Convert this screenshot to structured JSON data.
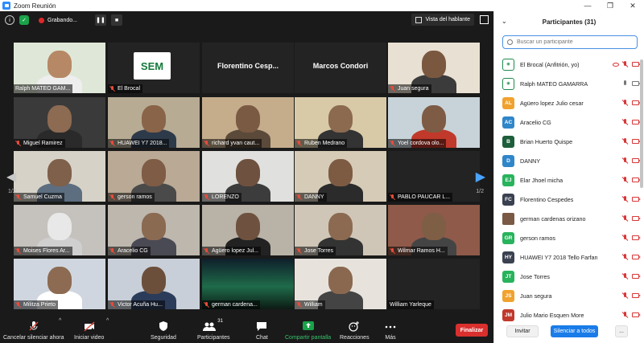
{
  "window": {
    "title": "Zoom Reunión",
    "controls": [
      "—",
      "❐",
      "✕"
    ]
  },
  "topbar": {
    "recording_label": "Grabando...",
    "view_button": "Vista del hablante"
  },
  "gallery": {
    "page_left": "1/2",
    "page_right": "1/2",
    "tiles": [
      {
        "name": "Ralph MATEO GAM...",
        "active": true,
        "muted": false,
        "video": true,
        "scene": "#dfe8d8",
        "skin": "#b78866",
        "shirt": "#eeeeee"
      },
      {
        "name": "El Brocal",
        "muted": true,
        "video": false,
        "logo": "SEM"
      },
      {
        "name": "Florentino Cesp...",
        "muted": false,
        "video": false,
        "bigname": "Florentino  Cesp..."
      },
      {
        "name": "Marcos Condori",
        "muted": false,
        "video": false,
        "bigname": "Marcos Condori"
      },
      {
        "name": "Juan segura",
        "muted": true,
        "video": true,
        "scene": "#e8e0d2",
        "skin": "#7a5840",
        "shirt": "#3b3b3b"
      },
      {
        "name": "Miguel Ramirez",
        "muted": true,
        "video": true,
        "scene": "#3a3a3a",
        "skin": "#8d6a52",
        "shirt": "#2a2a2a"
      },
      {
        "name": "HUAWEI Y7 2018...",
        "muted": true,
        "video": true,
        "scene": "#b7ab94",
        "skin": "#8a6448",
        "shirt": "#2d3a4a"
      },
      {
        "name": "richard yvan caut...",
        "muted": true,
        "video": true,
        "scene": "#c5ad8c",
        "skin": "#7b5a43",
        "shirt": "#5b4a3a"
      },
      {
        "name": "Ruben Medrano",
        "muted": true,
        "video": true,
        "scene": "#d8c9a7",
        "skin": "#8b6a50",
        "shirt": "#333333"
      },
      {
        "name": "Yoel cordova olo...",
        "muted": true,
        "video": true,
        "scene": "#c7d3d9",
        "skin": "#7e5b44",
        "shirt": "#c0392b"
      },
      {
        "name": "Samuel Cuzma",
        "muted": true,
        "video": true,
        "scene": "#d7d2c7",
        "skin": "#7f604a",
        "shirt": "#5c6e80"
      },
      {
        "name": "gerson ramos",
        "muted": true,
        "video": true,
        "scene": "#b9a995",
        "skin": "#7e5c45",
        "shirt": "#4a4a4a"
      },
      {
        "name": "LORENZO",
        "muted": true,
        "video": true,
        "scene": "#e0e0de",
        "skin": "#6e513e",
        "shirt": "#3c3c3c"
      },
      {
        "name": "DANNY",
        "muted": true,
        "video": true,
        "scene": "#d6cbb6",
        "skin": "#7d5b43",
        "shirt": "#2b2b2b"
      },
      {
        "name": "PABLO PAUCAR L...",
        "muted": true,
        "video": false
      },
      {
        "name": "Moises Flores Ar...",
        "muted": true,
        "video": true,
        "scene": "#c5c2bd",
        "skin": "#e8e8e8",
        "shirt": "#cfcfcf"
      },
      {
        "name": "Aracelio CG",
        "muted": true,
        "video": true,
        "scene": "#bdb7ae",
        "skin": "#8b6a52",
        "shirt": "#4a4a55"
      },
      {
        "name": "Agüero lopez Jul...",
        "muted": true,
        "video": true,
        "scene": "#b9b2a6",
        "skin": "#6e523f",
        "shirt": "#222222"
      },
      {
        "name": "Jose Torres",
        "muted": true,
        "video": true,
        "scene": "#cfc6b7",
        "skin": "#8c6a51",
        "shirt": "#333333"
      },
      {
        "name": "Wilmar Ramos H...",
        "muted": true,
        "video": true,
        "scene": "#8f5a4a",
        "skin": "#7f5e46",
        "shirt": "#444444"
      },
      {
        "name": "Militza Prieto",
        "muted": true,
        "video": true,
        "scene": "#cfd6df",
        "skin": "#8c6b52",
        "shirt": "#ffffff"
      },
      {
        "name": "Victor Acuña Hu...",
        "muted": true,
        "video": true,
        "scene": "#c8cfd8",
        "skin": "#6c4f3b",
        "shirt": "#2b3b5a"
      },
      {
        "name": "german cardena...",
        "muted": true,
        "video": true,
        "scene": "#1c3b2f",
        "aurora": true
      },
      {
        "name": "William",
        "muted": true,
        "video": true,
        "scene": "#e7e3dc",
        "skin": "#8a684f",
        "shirt": "#444444"
      },
      {
        "name": "William Yarleque",
        "muted": false,
        "video": false
      }
    ]
  },
  "toolbar": {
    "mute": "Cancelar silenciar ahora",
    "video": "Iniciar video",
    "security": "Seguridad",
    "participants": "Participantes",
    "participants_count": "31",
    "chat": "Chat",
    "share": "Compartir pantalla",
    "reactions": "Reacciones",
    "more": "Más",
    "finish": "Finalizar"
  },
  "panel": {
    "title": "Participantes (31)",
    "search_placeholder": "Buscar un participante",
    "invite": "Invitar",
    "mute_all": "Silenciar a todos",
    "more": "...",
    "participants": [
      {
        "name": "El Brocal (Anfitrión, yo)",
        "avatar": "logo",
        "color": "#1f8a4c",
        "eye": true,
        "mic": "off",
        "cam": "off"
      },
      {
        "name": "Ralph MATEO GAMARRA",
        "avatar": "logo",
        "color": "#1f8a4c",
        "mic": "on",
        "cam": "on"
      },
      {
        "name": "Agüero lopez Julio cesar",
        "initials": "AL",
        "color": "#f0a22e",
        "mic": "off",
        "cam": "on"
      },
      {
        "name": "Aracelio CG",
        "initials": "AC",
        "color": "#2f86c9",
        "mic": "off",
        "cam": "on"
      },
      {
        "name": "Brian Huerto Quispe",
        "initials": "B",
        "color": "#1e5e3a",
        "mic": "off",
        "cam": "on"
      },
      {
        "name": "DANNY",
        "initials": "D",
        "color": "#2f86c9",
        "mic": "off",
        "cam": "on"
      },
      {
        "name": "Elar Jhoel micha",
        "initials": "EJ",
        "color": "#28b35c",
        "mic": "off",
        "cam": "on"
      },
      {
        "name": "Florentino Cespedes",
        "initials": "FC",
        "color": "#3a4150",
        "mic": "off",
        "cam": "on"
      },
      {
        "name": "german cardenas orizano",
        "avatar": "photo",
        "color": "#7a5a44",
        "mic": "off",
        "cam": "on"
      },
      {
        "name": "gerson ramos",
        "initials": "GR",
        "color": "#28b35c",
        "mic": "off",
        "cam": "on"
      },
      {
        "name": "HUAWEI Y7 2018 Tello Farfan",
        "initials": "HY",
        "color": "#3a4150",
        "mic": "off",
        "cam": "on"
      },
      {
        "name": "Jose Torres",
        "initials": "JT",
        "color": "#28b35c",
        "mic": "off",
        "cam": "on"
      },
      {
        "name": "Juan segura",
        "initials": "JS",
        "color": "#f0a22e",
        "mic": "off",
        "cam": "on"
      },
      {
        "name": "Julio Mario Esquen More",
        "initials": "JM",
        "color": "#c0392b",
        "mic": "off",
        "cam": "on"
      }
    ]
  }
}
